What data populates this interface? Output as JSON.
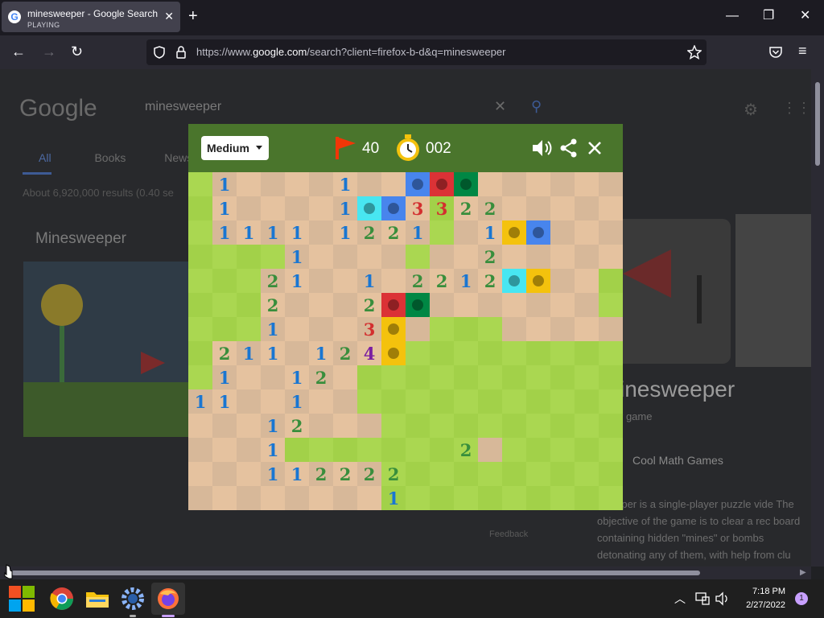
{
  "browser": {
    "tab": {
      "title": "minesweeper - Google Search",
      "subtitle": "PLAYING",
      "favicon": "G"
    },
    "url_prefix": "https://www.",
    "url_domain": "google.com",
    "url_rest": "/search?client=firefox-b-d&q=minesweeper"
  },
  "google": {
    "logo": "Google",
    "query": "minesweeper",
    "tabs": [
      "All",
      "Books",
      "News"
    ],
    "results_count": "About 6,920,000 results (0.40 se",
    "card_title": "Minesweeper",
    "kp_title": "inesweeper",
    "kp_subtitle": "r game",
    "kp_link": "Cool Math Games",
    "kp_desc": "sweeper is a single-player puzzle vide The objective of the game is to clear a rec board containing hidden \"mines\" or bombs detonating any of them, with help from clu",
    "feedback": "Feedback"
  },
  "game": {
    "difficulty": "Medium",
    "flags": "40",
    "time": "002",
    "colors": {
      "header": "#4a752c",
      "grass_light": "#aad751",
      "grass_dark": "#a2d149",
      "dirt_light": "#e5c29f",
      "dirt_dark": "#d7b899"
    },
    "cols": 18,
    "rows": 14,
    "revealed": [
      "-.........-.......",
      "-.........-.......",
      "-.........-.......",
      "----.....-........",
      "---..............-",
      "---..............-",
      "---.......---.....",
      "-........---------",
      "-......-----------",
      ".......-----------",
      "........----------",
      "....--------.-----",
      "........----------",
      "........----------"
    ],
    "numbers": [
      {
        "r": 0,
        "c": 1,
        "n": "1"
      },
      {
        "r": 0,
        "c": 6,
        "n": "1"
      },
      {
        "r": 1,
        "c": 1,
        "n": "1"
      },
      {
        "r": 1,
        "c": 6,
        "n": "1"
      },
      {
        "r": 1,
        "c": 9,
        "n": "3"
      },
      {
        "r": 1,
        "c": 10,
        "n": "3"
      },
      {
        "r": 1,
        "c": 11,
        "n": "2"
      },
      {
        "r": 1,
        "c": 12,
        "n": "2"
      },
      {
        "r": 2,
        "c": 1,
        "n": "1"
      },
      {
        "r": 2,
        "c": 2,
        "n": "1"
      },
      {
        "r": 2,
        "c": 3,
        "n": "1"
      },
      {
        "r": 2,
        "c": 4,
        "n": "1"
      },
      {
        "r": 2,
        "c": 6,
        "n": "1"
      },
      {
        "r": 2,
        "c": 7,
        "n": "2"
      },
      {
        "r": 2,
        "c": 8,
        "n": "2"
      },
      {
        "r": 2,
        "c": 9,
        "n": "1"
      },
      {
        "r": 2,
        "c": 12,
        "n": "1"
      },
      {
        "r": 3,
        "c": 4,
        "n": "1"
      },
      {
        "r": 3,
        "c": 12,
        "n": "2"
      },
      {
        "r": 4,
        "c": 3,
        "n": "2"
      },
      {
        "r": 4,
        "c": 4,
        "n": "1"
      },
      {
        "r": 4,
        "c": 7,
        "n": "1"
      },
      {
        "r": 4,
        "c": 9,
        "n": "2"
      },
      {
        "r": 4,
        "c": 10,
        "n": "2"
      },
      {
        "r": 4,
        "c": 11,
        "n": "1"
      },
      {
        "r": 4,
        "c": 12,
        "n": "2"
      },
      {
        "r": 5,
        "c": 3,
        "n": "2"
      },
      {
        "r": 5,
        "c": 7,
        "n": "2"
      },
      {
        "r": 6,
        "c": 3,
        "n": "1"
      },
      {
        "r": 6,
        "c": 7,
        "n": "3"
      },
      {
        "r": 7,
        "c": 1,
        "n": "2"
      },
      {
        "r": 7,
        "c": 2,
        "n": "1"
      },
      {
        "r": 7,
        "c": 3,
        "n": "1"
      },
      {
        "r": 7,
        "c": 5,
        "n": "1"
      },
      {
        "r": 7,
        "c": 6,
        "n": "2"
      },
      {
        "r": 7,
        "c": 7,
        "n": "4"
      },
      {
        "r": 8,
        "c": 1,
        "n": "1"
      },
      {
        "r": 8,
        "c": 4,
        "n": "1"
      },
      {
        "r": 8,
        "c": 5,
        "n": "2"
      },
      {
        "r": 9,
        "c": 0,
        "n": "1"
      },
      {
        "r": 9,
        "c": 1,
        "n": "1"
      },
      {
        "r": 9,
        "c": 4,
        "n": "1"
      },
      {
        "r": 10,
        "c": 3,
        "n": "1"
      },
      {
        "r": 10,
        "c": 4,
        "n": "2"
      },
      {
        "r": 11,
        "c": 3,
        "n": "1"
      },
      {
        "r": 11,
        "c": 11,
        "n": "2"
      },
      {
        "r": 12,
        "c": 3,
        "n": "1"
      },
      {
        "r": 12,
        "c": 4,
        "n": "1"
      },
      {
        "r": 12,
        "c": 5,
        "n": "2"
      },
      {
        "r": 12,
        "c": 6,
        "n": "2"
      },
      {
        "r": 12,
        "c": 7,
        "n": "2"
      },
      {
        "r": 12,
        "c": 8,
        "n": "2"
      },
      {
        "r": 13,
        "c": 8,
        "n": "1"
      }
    ],
    "mines": [
      {
        "r": 0,
        "c": 9,
        "color": "#4885ed"
      },
      {
        "r": 0,
        "c": 10,
        "color": "#db3236"
      },
      {
        "r": 0,
        "c": 11,
        "color": "#008744"
      },
      {
        "r": 1,
        "c": 7,
        "color": "#48e6f1"
      },
      {
        "r": 1,
        "c": 8,
        "color": "#4885ed"
      },
      {
        "r": 2,
        "c": 13,
        "color": "#f4c20d"
      },
      {
        "r": 2,
        "c": 14,
        "color": "#4885ed"
      },
      {
        "r": 4,
        "c": 13,
        "color": "#48e6f1"
      },
      {
        "r": 4,
        "c": 14,
        "color": "#f4c20d"
      },
      {
        "r": 5,
        "c": 8,
        "color": "#db3236"
      },
      {
        "r": 5,
        "c": 9,
        "color": "#008744"
      },
      {
        "r": 6,
        "c": 8,
        "color": "#f4c20d"
      },
      {
        "r": 7,
        "c": 8,
        "color": "#f4c20d"
      }
    ],
    "number_colors": {
      "1": "#1976d2",
      "2": "#388e3c",
      "3": "#d32f2f",
      "4": "#7b1fa2"
    }
  },
  "taskbar": {
    "time": "7:18 PM",
    "date": "2/27/2022",
    "notifications": "1"
  }
}
